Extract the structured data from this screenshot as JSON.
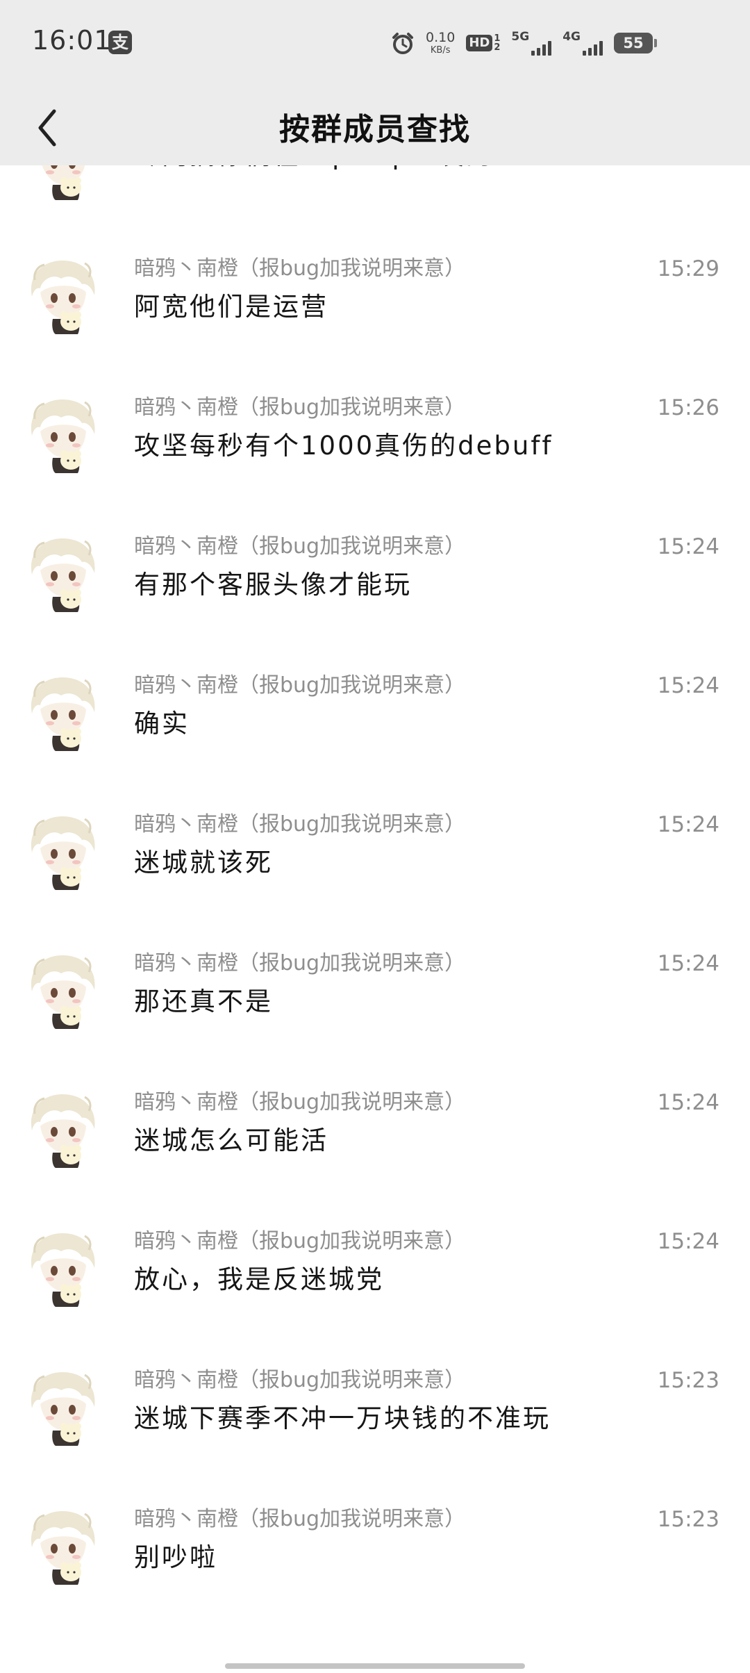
{
  "status_bar": {
    "time": "16:01",
    "notification_glyph": "支",
    "speed_value": "0.10",
    "speed_unit": "KB/s",
    "hd_label": "HD",
    "hd_sim_top": "1",
    "hd_sim_bottom": "2",
    "net1_label": "5G",
    "net2_label": "4G",
    "battery": "55",
    "icons": [
      "alarm-icon",
      "signal-icon",
      "battery-icon"
    ]
  },
  "nav": {
    "back_icon": "chevron-left-icon",
    "title": "按群成员查找"
  },
  "messages": [
    {
      "sender": "",
      "time": "",
      "text": "专门搞你们在Tap Tap上发的"
    },
    {
      "sender": "暗鸦丶南橙（报bug加我说明来意）",
      "time": "15:29",
      "text": "阿宽他们是运营"
    },
    {
      "sender": "暗鸦丶南橙（报bug加我说明来意）",
      "time": "15:26",
      "text": "攻坚每秒有个1000真伤的debuff"
    },
    {
      "sender": "暗鸦丶南橙（报bug加我说明来意）",
      "time": "15:24",
      "text": "有那个客服头像才能玩"
    },
    {
      "sender": "暗鸦丶南橙（报bug加我说明来意）",
      "time": "15:24",
      "text": "确实"
    },
    {
      "sender": "暗鸦丶南橙（报bug加我说明来意）",
      "time": "15:24",
      "text": "迷城就该死"
    },
    {
      "sender": "暗鸦丶南橙（报bug加我说明来意）",
      "time": "15:24",
      "text": "那还真不是"
    },
    {
      "sender": "暗鸦丶南橙（报bug加我说明来意）",
      "time": "15:24",
      "text": "迷城怎么可能活"
    },
    {
      "sender": "暗鸦丶南橙（报bug加我说明来意）",
      "time": "15:24",
      "text": "放心，我是反迷城党"
    },
    {
      "sender": "暗鸦丶南橙（报bug加我说明来意）",
      "time": "15:23",
      "text": "迷城下赛季不冲一万块钱的不准玩"
    },
    {
      "sender": "暗鸦丶南橙（报bug加我说明来意）",
      "time": "15:23",
      "text": "别吵啦"
    }
  ],
  "colors": {
    "topbar_bg": "#ececec",
    "meta_text": "#8e8e8e",
    "message_text": "#151515"
  }
}
